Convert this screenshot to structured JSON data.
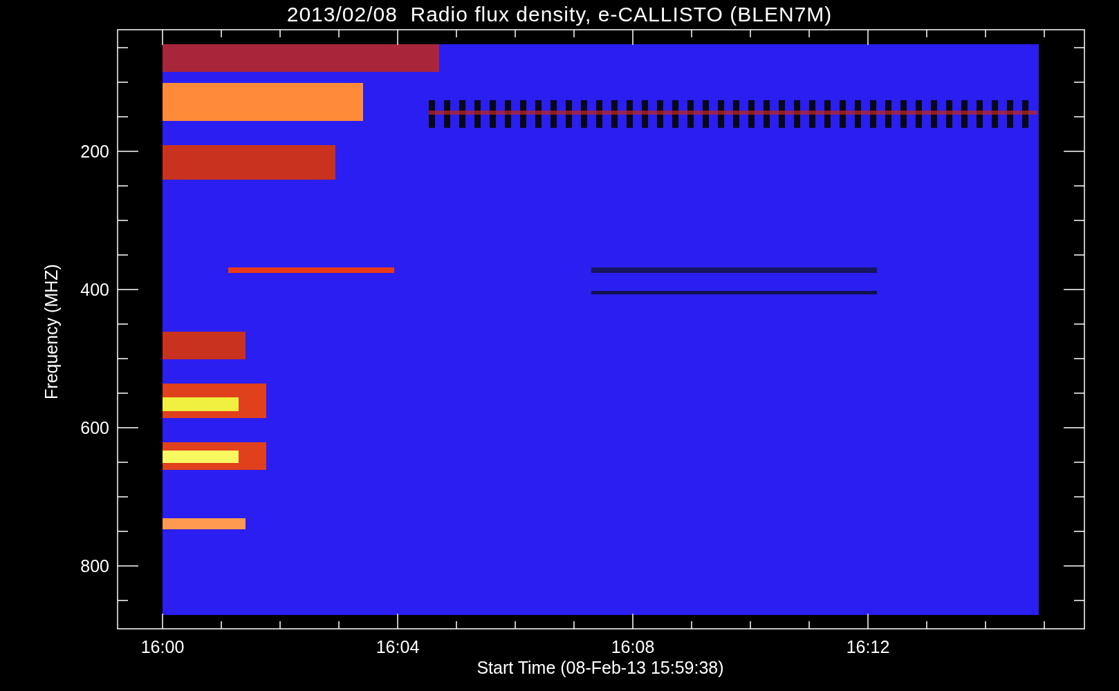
{
  "chart": {
    "title": "2013/02/08  Radio flux density, e-CALLISTO (BLEN7M)",
    "xlabel": "Start Time (08-Feb-13 15:59:38)",
    "ylabel": "Frequency (MHZ)",
    "xticks": [
      "16:00",
      "16:04",
      "16:08",
      "16:12"
    ],
    "yticks": [
      "200",
      "400",
      "600",
      "800"
    ]
  }
}
